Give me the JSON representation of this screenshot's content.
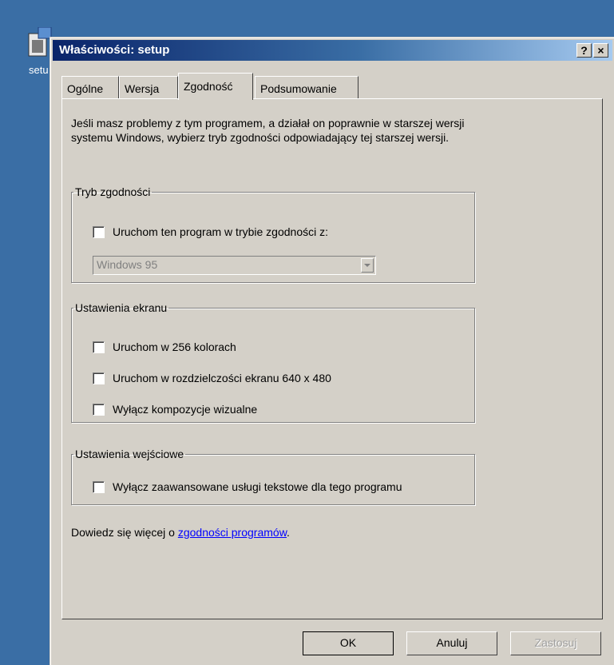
{
  "desktop": {
    "icon_label": "setu"
  },
  "window": {
    "title": "Właściwości: setup",
    "help_label": "?",
    "close_label": "×"
  },
  "tabs": [
    {
      "label": "Ogólne"
    },
    {
      "label": "Wersja"
    },
    {
      "label": "Zgodność"
    },
    {
      "label": "Podsumowanie"
    }
  ],
  "intro": "Jeśli masz problemy z tym programem, a działał on poprawnie w starszej wersji systemu Windows, wybierz tryb zgodności odpowiadający tej starszej wersji.",
  "compat_mode": {
    "legend": "Tryb zgodności",
    "checkbox_label": "Uruchom ten program w trybie zgodności z:",
    "select_value": "Windows 95"
  },
  "display": {
    "legend": "Ustawienia ekranu",
    "options": [
      "Uruchom w 256 kolorach",
      "Uruchom w rozdzielczości ekranu 640 x 480",
      "Wyłącz kompozycje wizualne"
    ]
  },
  "input": {
    "legend": "Ustawienia wejściowe",
    "option": "Wyłącz zaawansowane usługi tekstowe dla tego programu"
  },
  "learn_more": {
    "prefix": "Dowiedz się więcej o ",
    "link": "zgodności programów",
    "suffix": "."
  },
  "buttons": {
    "ok": "OK",
    "cancel": "Anuluj",
    "apply": "Zastosuj"
  }
}
